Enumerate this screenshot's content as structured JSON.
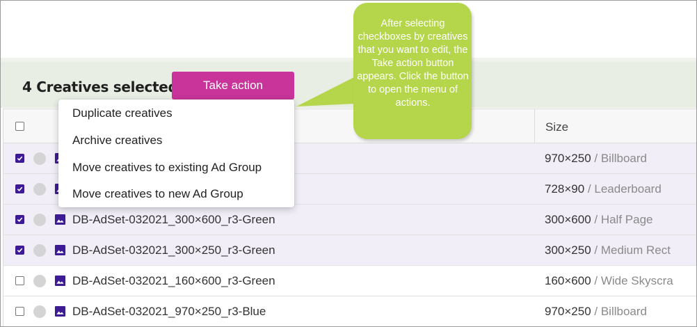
{
  "selection": {
    "count_text": "4 Creatives selected",
    "take_action_label": "Take action"
  },
  "menu": {
    "items": [
      "Duplicate creatives",
      "Archive creatives",
      "Move creatives to existing Ad Group",
      "Move creatives to new Ad Group"
    ]
  },
  "callout": {
    "text": "After selecting checkboxes by creatives that you want to edit, the Take action button appears. Click the button to open the menu of actions."
  },
  "table": {
    "columns": {
      "size": "Size"
    },
    "rows": [
      {
        "name": "",
        "size": "970×250",
        "size_type": " / Billboard",
        "selected": true
      },
      {
        "name": "",
        "size": "728×90",
        "size_type": " / Leaderboard",
        "selected": true
      },
      {
        "name": "DB-AdSet-032021_300×600_r3-Green",
        "size": "300×600",
        "size_type": " / Half Page",
        "selected": true
      },
      {
        "name": "DB-AdSet-032021_300×250_r3-Green",
        "size": "300×250",
        "size_type": " / Medium Rect",
        "selected": true
      },
      {
        "name": "DB-AdSet-032021_160×600_r3-Green",
        "size": "160×600",
        "size_type": " / Wide Skyscra",
        "selected": false
      },
      {
        "name": "DB-AdSet-032021_970×250_r3-Blue",
        "size": "970×250",
        "size_type": " / Billboard",
        "selected": false
      }
    ]
  },
  "colors": {
    "accent": "#c8349a",
    "checkbox": "#3d1b94",
    "callout": "#b5d64a",
    "selection_bar": "#e8eee4",
    "selected_row": "#f1eef8"
  },
  "icons": {
    "status": "status-dot-icon",
    "creative": "image-icon",
    "check": "check-icon"
  }
}
